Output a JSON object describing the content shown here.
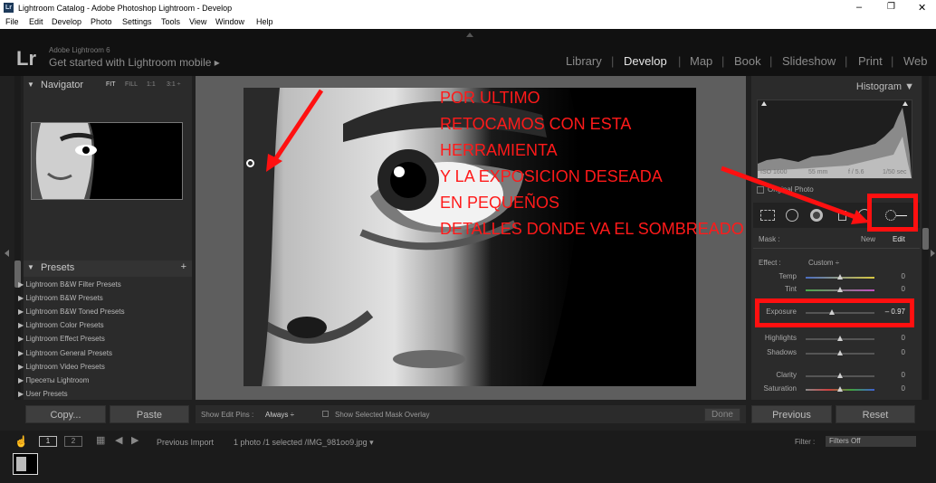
{
  "window": {
    "title": "Lightroom Catalog - Adobe Photoshop Lightroom - Develop",
    "icon": "Lr",
    "min": "–",
    "restore": "❐",
    "close": "✕"
  },
  "menu": [
    "File",
    "Edit",
    "Develop",
    "Photo",
    "Settings",
    "Tools",
    "View",
    "Window",
    "Help"
  ],
  "brand": {
    "logo": "Lr",
    "version": "Adobe Lightroom 6",
    "mobile": "Get started with Lightroom mobile ▸"
  },
  "modules": {
    "items": [
      "Library",
      "Develop",
      "Map",
      "Book",
      "Slideshow",
      "Print",
      "Web"
    ],
    "active": "Develop"
  },
  "navigator": {
    "title": "Navigator",
    "zoom": [
      "FIT",
      "FILL",
      "1:1",
      "3:1 ÷"
    ]
  },
  "presets": {
    "title": "Presets",
    "add": "+",
    "items": [
      "Lightroom B&W Filter Presets",
      "Lightroom B&W Presets",
      "Lightroom B&W Toned Presets",
      "Lightroom Color Presets",
      "Lightroom Effect Presets",
      "Lightroom General Presets",
      "Lightroom Video Presets",
      "Пресеты Lightroom",
      "User Presets"
    ]
  },
  "left_buttons": {
    "copy": "Copy...",
    "paste": "Paste"
  },
  "histogram": {
    "title": "Histogram ▼",
    "iso": "ISO 1600",
    "focal": "55 mm",
    "aperture": "f / 5.6",
    "shutter": "1/50 sec",
    "original": "Original Photo"
  },
  "mask": {
    "label": "Mask :",
    "new": "New",
    "edit": "Edit"
  },
  "effect": {
    "label": "Effect :",
    "value": "Custom ÷"
  },
  "sliders": [
    {
      "label": "Temp",
      "value": "0",
      "pos": 0.5
    },
    {
      "label": "Tint",
      "value": "0",
      "pos": 0.5
    },
    {
      "label": "Exposure",
      "value": "– 0.97",
      "pos": 0.38
    },
    {
      "label": "Highlights",
      "value": "0",
      "pos": 0.5
    },
    {
      "label": "Shadows",
      "value": "0",
      "pos": 0.5
    },
    {
      "label": "Clarity",
      "value": "0",
      "pos": 0.5
    },
    {
      "label": "Saturation",
      "value": "0",
      "pos": 0.5
    }
  ],
  "right_buttons": {
    "previous": "Previous",
    "reset": "Reset"
  },
  "toolbar": {
    "pins_label": "Show Edit Pins :",
    "pins_value": "Always ÷",
    "overlay": "Show Selected Mask Overlay",
    "done": "Done"
  },
  "filmstrip": {
    "page1": "1",
    "page2": "2",
    "prev_import": "Previous Import",
    "info": "1 photo /1 selected /IMG_981oo9.jpg ▾",
    "filter_label": "Filter :",
    "filter_value": "Filters Off"
  },
  "annotation": {
    "color": "#ff1a1a",
    "lines": [
      "POR ULTIMO",
      "RETOCAMOS CON ESTA",
      "HERRAMIENTA",
      "Y LA EXPOSICION DESEADA",
      "EN PEQUEÑOS",
      "DETALLES DONDE VA EL SOMBREADO"
    ]
  }
}
